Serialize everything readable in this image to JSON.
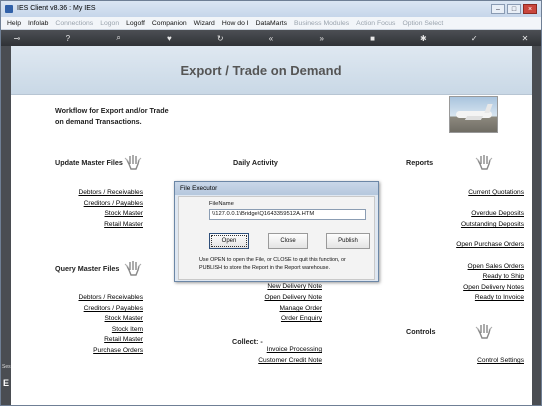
{
  "window": {
    "title": "IES Client v8.36 : My IES",
    "controls": [
      "–",
      "□",
      "×"
    ]
  },
  "menu": {
    "items": [
      {
        "label": "Help",
        "enabled": true
      },
      {
        "label": "Infolab",
        "enabled": true
      },
      {
        "label": "Connections",
        "enabled": false
      },
      {
        "label": "Logon",
        "enabled": false
      },
      {
        "label": "Logoff",
        "enabled": true
      },
      {
        "label": "Companion",
        "enabled": true
      },
      {
        "label": "Wizard",
        "enabled": true
      },
      {
        "label": "How do I",
        "enabled": true
      },
      {
        "label": "DataMarts",
        "enabled": true
      },
      {
        "label": "Business Modules",
        "enabled": false
      },
      {
        "label": "Action Focus",
        "enabled": false
      },
      {
        "label": "Option Select",
        "enabled": false
      }
    ]
  },
  "toolbar": {
    "icons": [
      {
        "name": "key-icon",
        "glyph": "⊸"
      },
      {
        "name": "help-icon",
        "glyph": "?"
      },
      {
        "name": "search-icon",
        "glyph": "⌕"
      },
      {
        "name": "heart-icon",
        "glyph": "♥"
      },
      {
        "name": "refresh-icon",
        "glyph": "↻"
      },
      {
        "name": "rewind-icon",
        "glyph": "«"
      },
      {
        "name": "fast-forward-icon",
        "glyph": "»"
      },
      {
        "name": "stop-icon",
        "glyph": "■"
      },
      {
        "name": "settings-icon",
        "glyph": "✱"
      },
      {
        "name": "check-icon",
        "glyph": "✓"
      },
      {
        "name": "close-icon",
        "glyph": "✕"
      }
    ]
  },
  "side": {
    "left_text": "Ses",
    "left_glyph": "E"
  },
  "page": {
    "title": "Export / Trade on Demand",
    "intro_line1": "Workflow for Export and/or Trade",
    "intro_line2": "on demand Transactions."
  },
  "sections": {
    "update_master": {
      "title": "Update Master Files",
      "links": [
        "Debtors / Receivables",
        "Creditors / Payables",
        "Stock Master",
        "Retail Master"
      ]
    },
    "query_master": {
      "title": "Query Master Files",
      "links": [
        "Debtors / Receivables",
        "Creditors / Payables",
        "Stock Master",
        "Stock Item",
        "Retail Master",
        "Purchase Orders"
      ]
    },
    "daily_activity": {
      "title": "Daily Activity",
      "links": [
        "New Delivery Note",
        "Open Delivery Note",
        "Manage Order",
        "Order Enquiry"
      ],
      "collect_label": "Collect: -",
      "collect_links": [
        "Invoice Processing",
        "Customer Credit Note"
      ]
    },
    "reports": {
      "title": "Reports",
      "links": [
        "Current Quotations",
        "Overdue Deposits",
        "Outstanding Deposits",
        "Open Purchase Orders",
        "Open Sales Orders",
        "Ready to Ship",
        "Open Delivery Notes",
        "Ready to Invoice"
      ]
    },
    "controls": {
      "title": "Controls",
      "links": [
        "Control Settings"
      ]
    }
  },
  "dialog": {
    "title": "File Executor",
    "field_label": "FileName",
    "field_value": "\\\\127.0.0.1\\Bridge\\Q1643359512A.HTM",
    "open_label": "Open",
    "close_label": "Close",
    "publish_label": "Publish",
    "help_text": "Use OPEN to open the File, or CLOSE to quit this function, or PUBLISH to store the Report in the Report warehouse."
  },
  "colors": {
    "toolbar_bg": "#3a3d42",
    "header_bg": "#d3dfeb",
    "dialog_bg": "#dfe7f1"
  }
}
